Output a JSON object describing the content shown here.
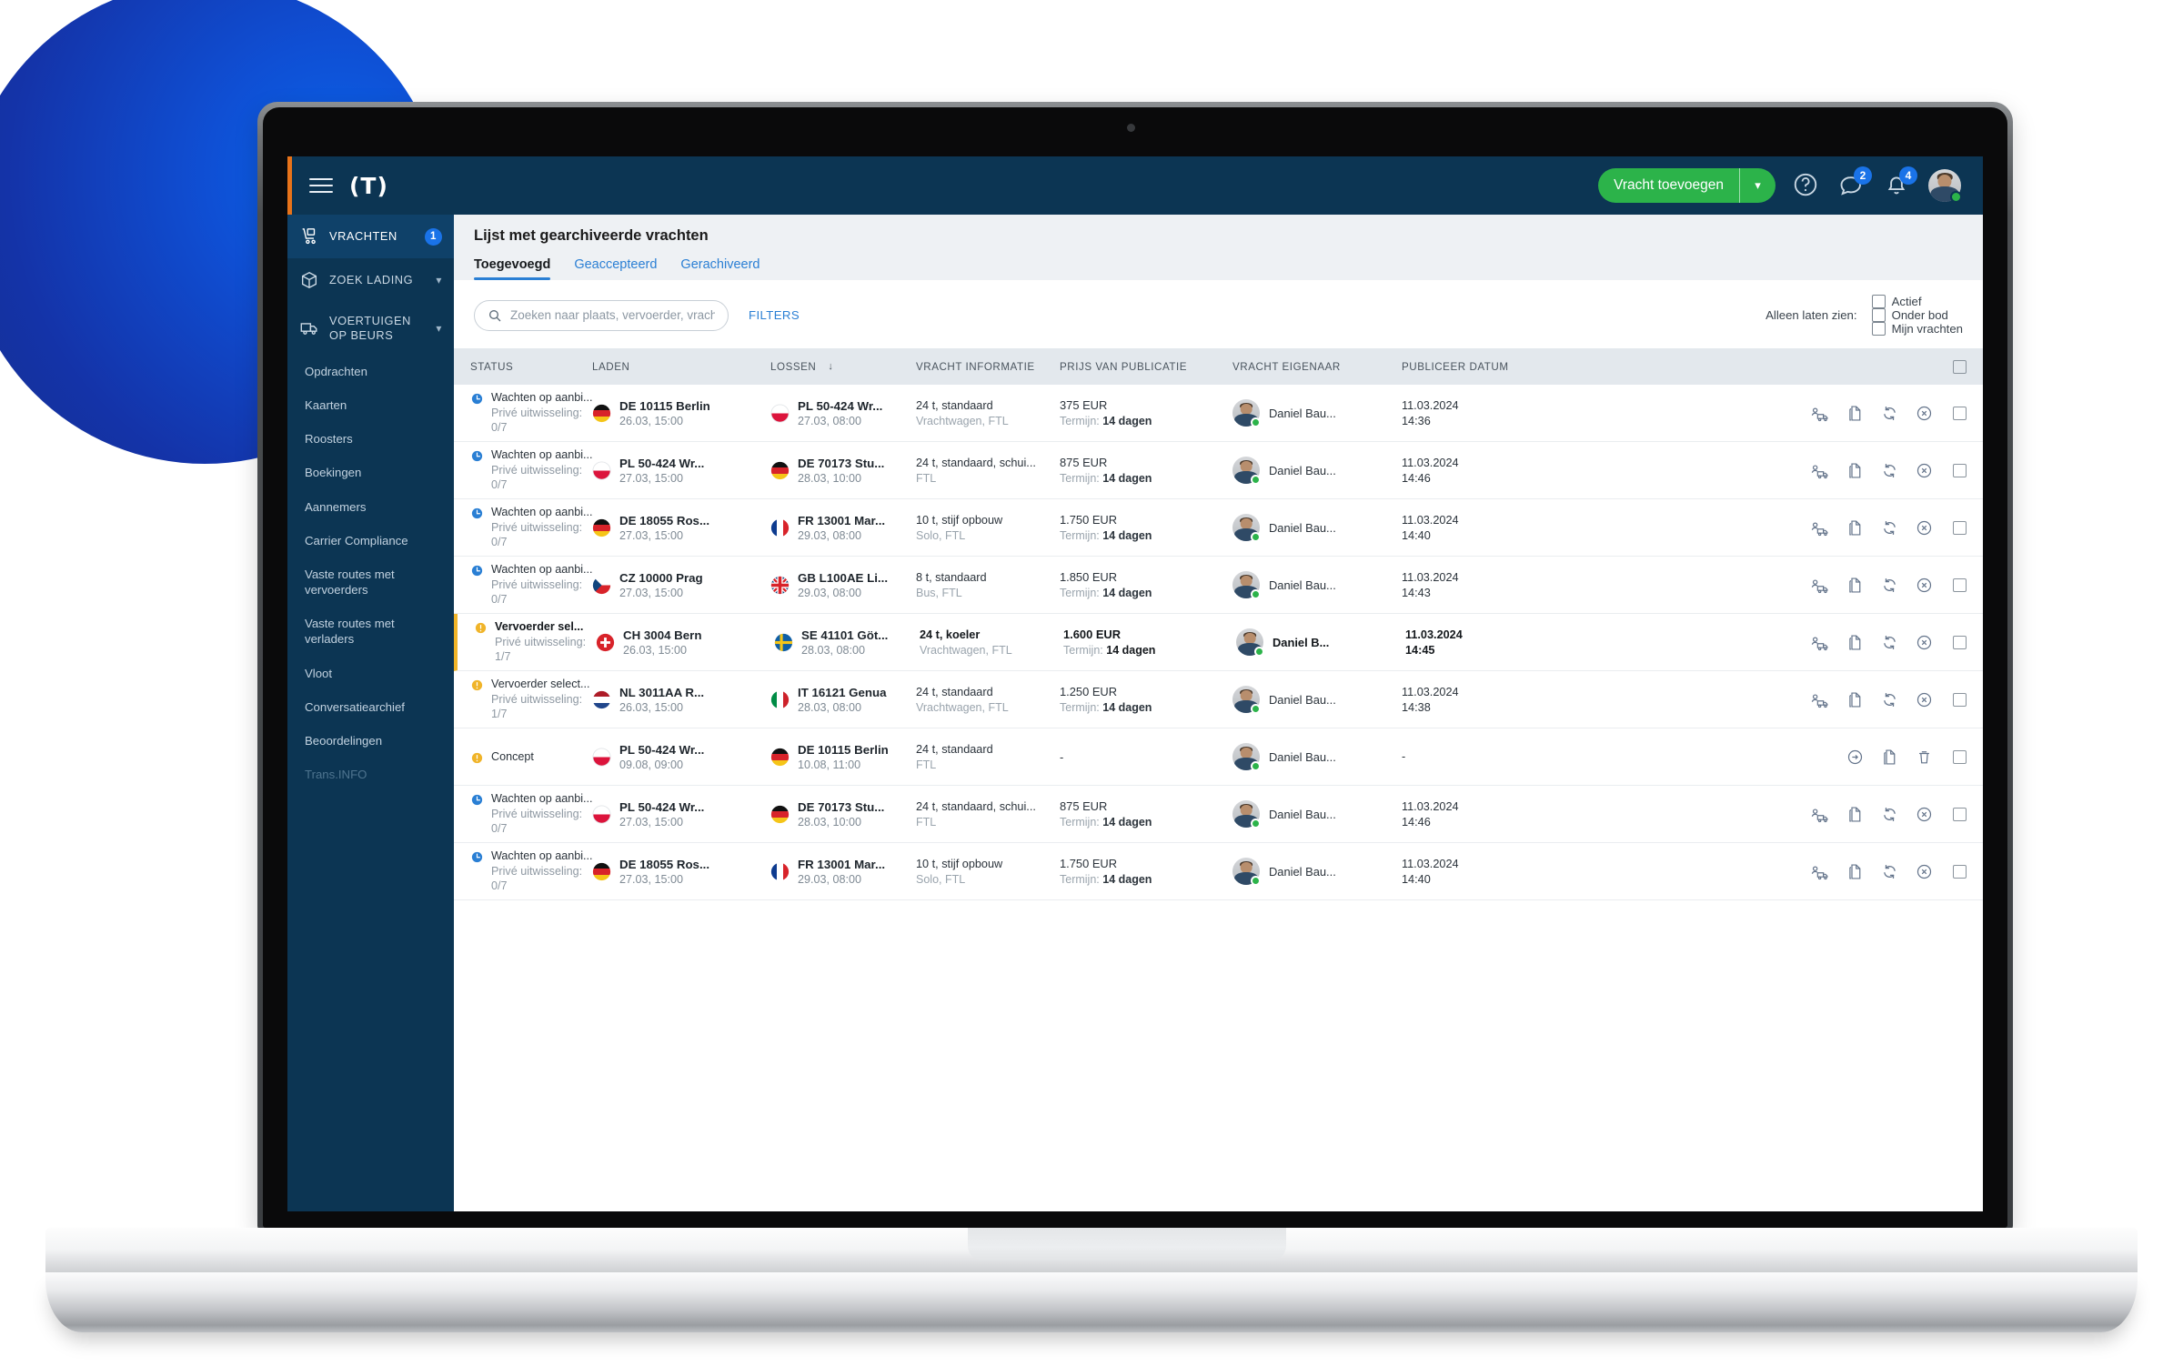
{
  "topbar": {
    "brand": "(T)",
    "add_freight_label": "Vracht toevoegen",
    "help_icon": "question-circle-icon",
    "chat_badge": "2",
    "bell_badge": "4"
  },
  "sidebar": {
    "main": [
      {
        "label": "VRACHTEN",
        "icon": "hand-truck-icon",
        "badge": "1",
        "active": true
      },
      {
        "label": "ZOEK LADING",
        "icon": "box-icon",
        "chevron": "∨"
      },
      {
        "label": "VOERTUIGEN OP BEURS",
        "icon": "truck-icon",
        "chevron": "∨"
      }
    ],
    "sub": [
      {
        "label": "Opdrachten"
      },
      {
        "label": "Kaarten"
      },
      {
        "label": "Roosters"
      },
      {
        "label": "Boekingen"
      },
      {
        "label": "Aannemers"
      },
      {
        "label": "Carrier Compliance"
      },
      {
        "label": "Vaste routes met vervoerders"
      },
      {
        "label": "Vaste routes met verladers"
      },
      {
        "label": "Vloot"
      },
      {
        "label": "Conversatiearchief"
      },
      {
        "label": "Beoordelingen"
      },
      {
        "label": "Trans.INFO",
        "muted": true
      }
    ]
  },
  "page": {
    "title": "Lijst met gearchiveerde vrachten",
    "tabs": [
      {
        "label": "Toegevoegd",
        "active": true
      },
      {
        "label": "Geaccepteerd"
      },
      {
        "label": "Gerachiveerd"
      }
    ]
  },
  "toolbar": {
    "search_placeholder": "Zoeken naar plaats, vervoerder, vrachtnumme...",
    "search_value": "",
    "filters_label": "FILTERS",
    "only_show_label": "Alleen laten zien:",
    "checkboxes": [
      {
        "label": "Actief",
        "checked": false
      },
      {
        "label": "Onder bod",
        "checked": false
      },
      {
        "label": "Mijn vrachten",
        "checked": false
      }
    ]
  },
  "table": {
    "headers": {
      "status": "STATUS",
      "laden": "LADEN",
      "lossen": "LOSSEN",
      "lossen_sort": "↓",
      "info": "VRACHT INFORMATIE",
      "price": "PRIJS VAN PUBLICATIE",
      "owner": "VRACHT EIGENAAR",
      "pub": "PUBLICEER DATUM"
    },
    "rows": [
      {
        "status_icon": "clock-icon",
        "status_icon_color": "#2a7fd4",
        "status_title": "Wachten op aanbi...",
        "status_sub": "Privé uitwisseling: 0/7",
        "load_flag": "de",
        "load_place": "DE 10115 Berlin",
        "load_date": "26.03, 15:00",
        "unload_flag": "pl",
        "unload_place": "PL 50-424 Wr...",
        "unload_date": "27.03, 08:00",
        "info_main": "24 t, standaard",
        "info_sub": "Vrachtwagen, FTL",
        "price": "375 EUR",
        "term_label": "Termijn:",
        "term_value": "14 dagen",
        "owner": "Daniel Bau...",
        "pub_date": "11.03.2024",
        "pub_time": "14:36",
        "actions": [
          "assign-carrier-icon",
          "copy-icon",
          "republish-icon",
          "cancel-icon"
        ],
        "highlight": false
      },
      {
        "status_icon": "clock-icon",
        "status_icon_color": "#2a7fd4",
        "status_title": "Wachten op aanbi...",
        "status_sub": "Privé uitwisseling: 0/7",
        "load_flag": "pl",
        "load_place": "PL 50-424 Wr...",
        "load_date": "27.03, 15:00",
        "unload_flag": "de",
        "unload_place": "DE 70173 Stu...",
        "unload_date": "28.03, 10:00",
        "info_main": "24 t, standaard, schui...",
        "info_sub": "FTL",
        "price": "875 EUR",
        "term_label": "Termijn:",
        "term_value": "14 dagen",
        "owner": "Daniel Bau...",
        "pub_date": "11.03.2024",
        "pub_time": "14:46",
        "actions": [
          "assign-carrier-icon",
          "copy-icon",
          "republish-icon",
          "cancel-icon"
        ],
        "highlight": false
      },
      {
        "status_icon": "clock-icon",
        "status_icon_color": "#2a7fd4",
        "status_title": "Wachten op aanbi...",
        "status_sub": "Privé uitwisseling: 0/7",
        "load_flag": "de",
        "load_place": "DE 18055 Ros...",
        "load_date": "27.03, 15:00",
        "unload_flag": "fr",
        "unload_place": "FR 13001 Mar...",
        "unload_date": "29.03, 08:00",
        "info_main": "10 t, stijf opbouw",
        "info_sub": "Solo, FTL",
        "price": "1.750 EUR",
        "term_label": "Termijn:",
        "term_value": "14 dagen",
        "owner": "Daniel Bau...",
        "pub_date": "11.03.2024",
        "pub_time": "14:40",
        "actions": [
          "assign-carrier-icon",
          "copy-icon",
          "republish-icon",
          "cancel-icon"
        ],
        "highlight": false
      },
      {
        "status_icon": "clock-icon",
        "status_icon_color": "#2a7fd4",
        "status_title": "Wachten op aanbi...",
        "status_sub": "Privé uitwisseling: 0/7",
        "load_flag": "cz",
        "load_place": "CZ 10000 Prag",
        "load_date": "27.03, 15:00",
        "unload_flag": "gb",
        "unload_place": "GB L100AE Li...",
        "unload_date": "29.03, 08:00",
        "info_main": "8 t, standaard",
        "info_sub": "Bus, FTL",
        "price": "1.850 EUR",
        "term_label": "Termijn:",
        "term_value": "14 dagen",
        "owner": "Daniel Bau...",
        "pub_date": "11.03.2024",
        "pub_time": "14:43",
        "actions": [
          "assign-carrier-icon",
          "copy-icon",
          "republish-icon",
          "cancel-icon"
        ],
        "highlight": false
      },
      {
        "status_icon": "warning-icon",
        "status_icon_color": "#f0b429",
        "status_title": "Vervoerder sel...",
        "status_sub": "Privé uitwisseling: 1/7",
        "load_flag": "ch",
        "load_place": "CH 3004 Bern",
        "load_date": "26.03, 15:00",
        "unload_flag": "se",
        "unload_place": "SE 41101 Göt...",
        "unload_date": "28.03, 08:00",
        "info_main": "24 t, koeler",
        "info_sub": "Vrachtwagen, FTL",
        "price": "1.600 EUR",
        "term_label": "Termijn:",
        "term_value": "14 dagen",
        "owner": "Daniel B...",
        "pub_date": "11.03.2024",
        "pub_time": "14:45",
        "actions": [
          "assign-carrier-icon",
          "copy-icon",
          "republish-icon",
          "cancel-icon"
        ],
        "highlight": true
      },
      {
        "status_icon": "warning-icon",
        "status_icon_color": "#f0b429",
        "status_title": "Vervoerder select...",
        "status_sub": "Privé uitwisseling: 1/7",
        "load_flag": "nl",
        "load_place": "NL 3011AA R...",
        "load_date": "26.03, 15:00",
        "unload_flag": "it",
        "unload_place": "IT 16121 Genua",
        "unload_date": "28.03, 08:00",
        "info_main": "24 t, standaard",
        "info_sub": "Vrachtwagen, FTL",
        "price": "1.250 EUR",
        "term_label": "Termijn:",
        "term_value": "14 dagen",
        "owner": "Daniel Bau...",
        "pub_date": "11.03.2024",
        "pub_time": "14:38",
        "actions": [
          "assign-carrier-icon",
          "copy-icon",
          "republish-icon",
          "cancel-icon"
        ],
        "highlight": false
      },
      {
        "status_icon": "warning-icon",
        "status_icon_color": "#f0b429",
        "status_title": "Concept",
        "status_sub": "",
        "load_flag": "pl",
        "load_place": "PL 50-424 Wr...",
        "load_date": "09.08, 09:00",
        "unload_flag": "de",
        "unload_place": "DE 10115 Berlin",
        "unload_date": "10.08, 11:00",
        "info_main": "24 t, standaard",
        "info_sub": "FTL",
        "price": "-",
        "term_label": "",
        "term_value": "",
        "owner": "Daniel Bau...",
        "pub_date": "-",
        "pub_time": "",
        "actions": [
          "publish-icon",
          "copy-icon",
          "delete-icon"
        ],
        "highlight": false
      },
      {
        "status_icon": "clock-icon",
        "status_icon_color": "#2a7fd4",
        "status_title": "Wachten op aanbi...",
        "status_sub": "Privé uitwisseling: 0/7",
        "load_flag": "pl",
        "load_place": "PL 50-424 Wr...",
        "load_date": "27.03, 15:00",
        "unload_flag": "de",
        "unload_place": "DE 70173 Stu...",
        "unload_date": "28.03, 10:00",
        "info_main": "24 t, standaard, schui...",
        "info_sub": "FTL",
        "price": "875 EUR",
        "term_label": "Termijn:",
        "term_value": "14 dagen",
        "owner": "Daniel Bau...",
        "pub_date": "11.03.2024",
        "pub_time": "14:46",
        "actions": [
          "assign-carrier-icon",
          "copy-icon",
          "republish-icon",
          "cancel-icon"
        ],
        "highlight": false
      },
      {
        "status_icon": "clock-icon",
        "status_icon_color": "#2a7fd4",
        "status_title": "Wachten op aanbi...",
        "status_sub": "Privé uitwisseling: 0/7",
        "load_flag": "de",
        "load_place": "DE 18055 Ros...",
        "load_date": "27.03, 15:00",
        "unload_flag": "fr",
        "unload_place": "FR 13001 Mar...",
        "unload_date": "29.03, 08:00",
        "info_main": "10 t, stijf opbouw",
        "info_sub": "Solo, FTL",
        "price": "1.750 EUR",
        "term_label": "Termijn:",
        "term_value": "14 dagen",
        "owner": "Daniel Bau...",
        "pub_date": "11.03.2024",
        "pub_time": "14:40",
        "actions": [
          "assign-carrier-icon",
          "copy-icon",
          "republish-icon",
          "cancel-icon"
        ],
        "highlight": false
      }
    ]
  },
  "colors": {
    "navy": "#0c3553",
    "accent_orange": "#e8731a",
    "green": "#2cb34a",
    "blue": "#2a7fd4",
    "amber": "#f0b429"
  }
}
